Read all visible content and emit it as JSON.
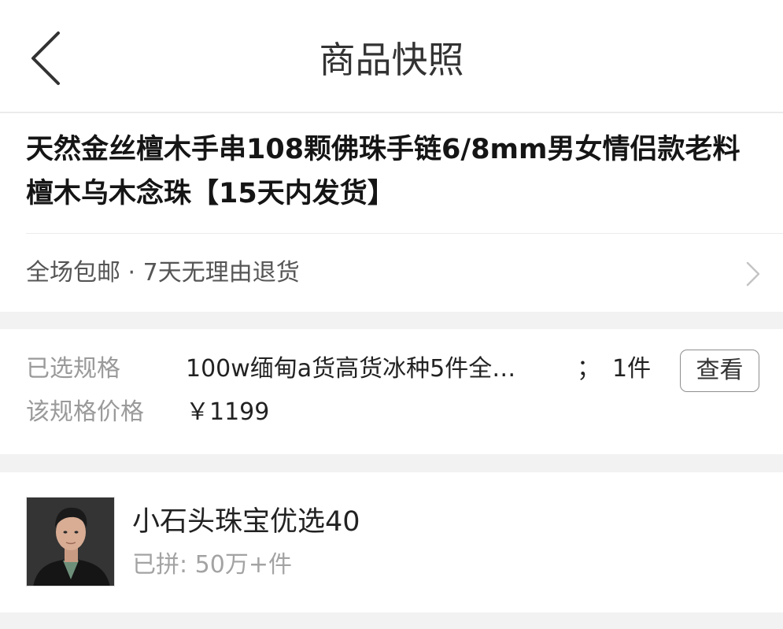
{
  "nav": {
    "title": "商品快照",
    "back_icon": "chevron-left-icon"
  },
  "product": {
    "title": "天然金丝檀木手串108颗佛珠手链6/8mm男女情侣款老料檀木乌木念珠【15天内发货】"
  },
  "service": {
    "text": "全场包邮 · 7天无理由退货",
    "arrow_icon": "chevron-right-icon"
  },
  "spec": {
    "selected_label": "已选规格",
    "selected_value": "100w缅甸a货高货冰种5件全…",
    "separator": "；",
    "quantity": "1件",
    "view_button": "查看",
    "price_label": "该规格价格",
    "price_value": "￥1199"
  },
  "shop": {
    "name": "小石头珠宝优选40",
    "sold": "已拼: 50万+件"
  },
  "colors": {
    "background": "#f2f2f2",
    "card": "#ffffff",
    "title_text": "#151515",
    "label_gray": "#9a9a9a"
  }
}
